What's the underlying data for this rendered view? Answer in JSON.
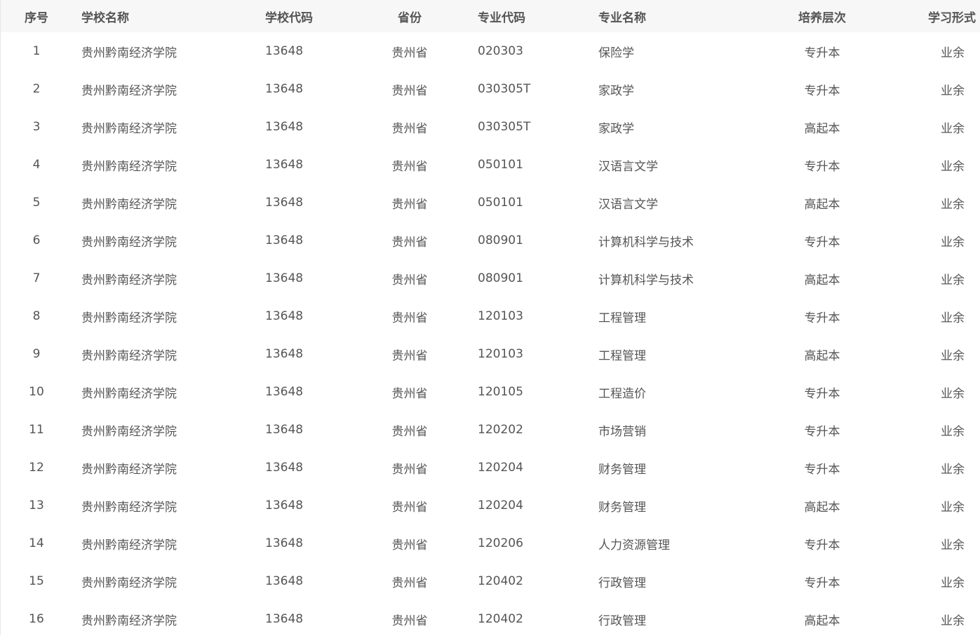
{
  "table": {
    "headers": {
      "index": "序号",
      "school_name": "学校名称",
      "school_code": "学校代码",
      "province": "省份",
      "major_code": "专业代码",
      "major_name": "专业名称",
      "level": "培养层次",
      "study_mode": "学习形式"
    },
    "rows": [
      {
        "index": "1",
        "school_name": "贵州黔南经济学院",
        "school_code": "13648",
        "province": "贵州省",
        "major_code": "020303",
        "major_name": "保险学",
        "level": "专升本",
        "study_mode": "业余"
      },
      {
        "index": "2",
        "school_name": "贵州黔南经济学院",
        "school_code": "13648",
        "province": "贵州省",
        "major_code": "030305T",
        "major_name": "家政学",
        "level": "专升本",
        "study_mode": "业余"
      },
      {
        "index": "3",
        "school_name": "贵州黔南经济学院",
        "school_code": "13648",
        "province": "贵州省",
        "major_code": "030305T",
        "major_name": "家政学",
        "level": "高起本",
        "study_mode": "业余"
      },
      {
        "index": "4",
        "school_name": "贵州黔南经济学院",
        "school_code": "13648",
        "province": "贵州省",
        "major_code": "050101",
        "major_name": "汉语言文学",
        "level": "专升本",
        "study_mode": "业余"
      },
      {
        "index": "5",
        "school_name": "贵州黔南经济学院",
        "school_code": "13648",
        "province": "贵州省",
        "major_code": "050101",
        "major_name": "汉语言文学",
        "level": "高起本",
        "study_mode": "业余"
      },
      {
        "index": "6",
        "school_name": "贵州黔南经济学院",
        "school_code": "13648",
        "province": "贵州省",
        "major_code": "080901",
        "major_name": "计算机科学与技术",
        "level": "专升本",
        "study_mode": "业余"
      },
      {
        "index": "7",
        "school_name": "贵州黔南经济学院",
        "school_code": "13648",
        "province": "贵州省",
        "major_code": "080901",
        "major_name": "计算机科学与技术",
        "level": "高起本",
        "study_mode": "业余"
      },
      {
        "index": "8",
        "school_name": "贵州黔南经济学院",
        "school_code": "13648",
        "province": "贵州省",
        "major_code": "120103",
        "major_name": "工程管理",
        "level": "专升本",
        "study_mode": "业余"
      },
      {
        "index": "9",
        "school_name": "贵州黔南经济学院",
        "school_code": "13648",
        "province": "贵州省",
        "major_code": "120103",
        "major_name": "工程管理",
        "level": "高起本",
        "study_mode": "业余"
      },
      {
        "index": "10",
        "school_name": "贵州黔南经济学院",
        "school_code": "13648",
        "province": "贵州省",
        "major_code": "120105",
        "major_name": "工程造价",
        "level": "专升本",
        "study_mode": "业余"
      },
      {
        "index": "11",
        "school_name": "贵州黔南经济学院",
        "school_code": "13648",
        "province": "贵州省",
        "major_code": "120202",
        "major_name": "市场营销",
        "level": "专升本",
        "study_mode": "业余"
      },
      {
        "index": "12",
        "school_name": "贵州黔南经济学院",
        "school_code": "13648",
        "province": "贵州省",
        "major_code": "120204",
        "major_name": "财务管理",
        "level": "专升本",
        "study_mode": "业余"
      },
      {
        "index": "13",
        "school_name": "贵州黔南经济学院",
        "school_code": "13648",
        "province": "贵州省",
        "major_code": "120204",
        "major_name": "财务管理",
        "level": "高起本",
        "study_mode": "业余"
      },
      {
        "index": "14",
        "school_name": "贵州黔南经济学院",
        "school_code": "13648",
        "province": "贵州省",
        "major_code": "120206",
        "major_name": "人力资源管理",
        "level": "专升本",
        "study_mode": "业余"
      },
      {
        "index": "15",
        "school_name": "贵州黔南经济学院",
        "school_code": "13648",
        "province": "贵州省",
        "major_code": "120402",
        "major_name": "行政管理",
        "level": "专升本",
        "study_mode": "业余"
      },
      {
        "index": "16",
        "school_name": "贵州黔南经济学院",
        "school_code": "13648",
        "province": "贵州省",
        "major_code": "120402",
        "major_name": "行政管理",
        "level": "高起本",
        "study_mode": "业余"
      }
    ]
  }
}
